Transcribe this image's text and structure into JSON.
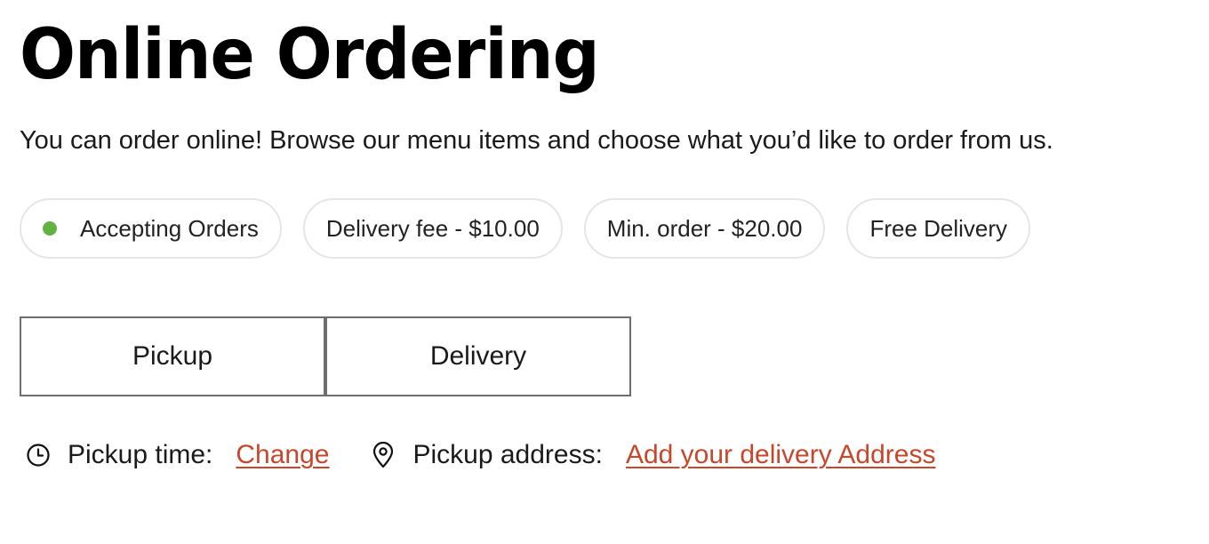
{
  "header": {
    "title": "Online Ordering",
    "subtitle": "You can order online! Browse our menu items and choose what you’d like to order from us."
  },
  "badges": {
    "status": {
      "label": "Accepting Orders",
      "color": "#63b344"
    },
    "delivery_fee": "Delivery fee - $10.00",
    "min_order": "Min. order - $20.00",
    "free_delivery": "Free Delivery"
  },
  "order_mode": {
    "pickup_label": "Pickup",
    "delivery_label": "Delivery"
  },
  "info": {
    "time_icon": "clock-icon",
    "time_label": "Pickup time:",
    "time_link": "Change",
    "address_icon": "map-pin-icon",
    "address_label": "Pickup address:",
    "address_link": "Add your delivery Address",
    "link_color": "#c8462b"
  }
}
